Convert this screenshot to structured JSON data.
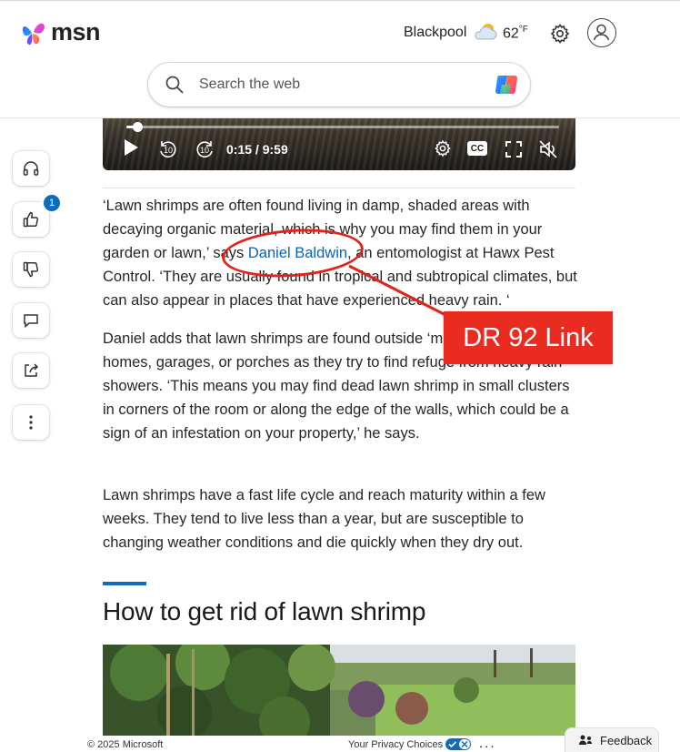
{
  "brand": {
    "name": "msn"
  },
  "header": {
    "location": "Blackpool",
    "temperature": "62",
    "temperature_unit": "°F",
    "weather_icon": "partly-cloudy-icon",
    "settings_icon": "gear-icon",
    "profile_icon": "avatar-icon"
  },
  "search": {
    "placeholder": "Search the web",
    "value": "",
    "copilot_icon": "copilot-icon"
  },
  "video": {
    "current_time": "0:15",
    "separator": "/",
    "duration": "9:59",
    "progress": 0.025,
    "controls": [
      "play-icon",
      "rewind-10-icon",
      "forward-10-icon",
      "settings-icon",
      "captions-icon",
      "fullscreen-icon",
      "mute-icon"
    ],
    "rewind_label": "10",
    "forward_label": "10",
    "cc_label": "CC"
  },
  "side_rail": {
    "items": [
      {
        "name": "listen",
        "icon": "headphones-icon"
      },
      {
        "name": "like",
        "icon": "thumbs-up-icon",
        "badge": "1"
      },
      {
        "name": "dislike",
        "icon": "thumbs-down-icon"
      },
      {
        "name": "comment",
        "icon": "comment-icon"
      },
      {
        "name": "share",
        "icon": "share-icon"
      },
      {
        "name": "more",
        "icon": "more-vertical-icon"
      }
    ]
  },
  "article": {
    "p1_before": "‘Lawn shrimps are often found living in damp, shaded areas with decaying organic material, which is why you may find them in your garden or lawn,’ says ",
    "p1_link": "Daniel Baldwin",
    "p1_after": ", an entomologist at Hawx Pest Control. ‘They are usually found in tropical and subtropical climates, but can also appear in places that have experienced heavy rain. ‘",
    "p2": "Daniel adds that lawn shrimps are found outside ‘mostly’, but will enter homes, garages, or porches as they try to find refuge from heavy rain showers. ‘This means you may find dead lawn shrimp in small clusters in corners of the room or along the edge of the walls, which could be a sign of an infestation on your property,’ he says.",
    "p3": "Lawn shrimps have a fast life cycle and reach maturity within a few weeks. They tend to live less than a year, but are susceptible to changing weather conditions and die quickly when they dry out.",
    "section_heading": "How to get rid of lawn shrimp"
  },
  "annotation": {
    "label": "DR 92 Link",
    "color": "#e2231a"
  },
  "footer": {
    "copyright": "© 2025 Microsoft",
    "privacy": "Your Privacy Choices",
    "more": "...",
    "feedback": "Feedback"
  },
  "colors": {
    "accent": "#0f6cbd",
    "link": "#0f62b0"
  }
}
